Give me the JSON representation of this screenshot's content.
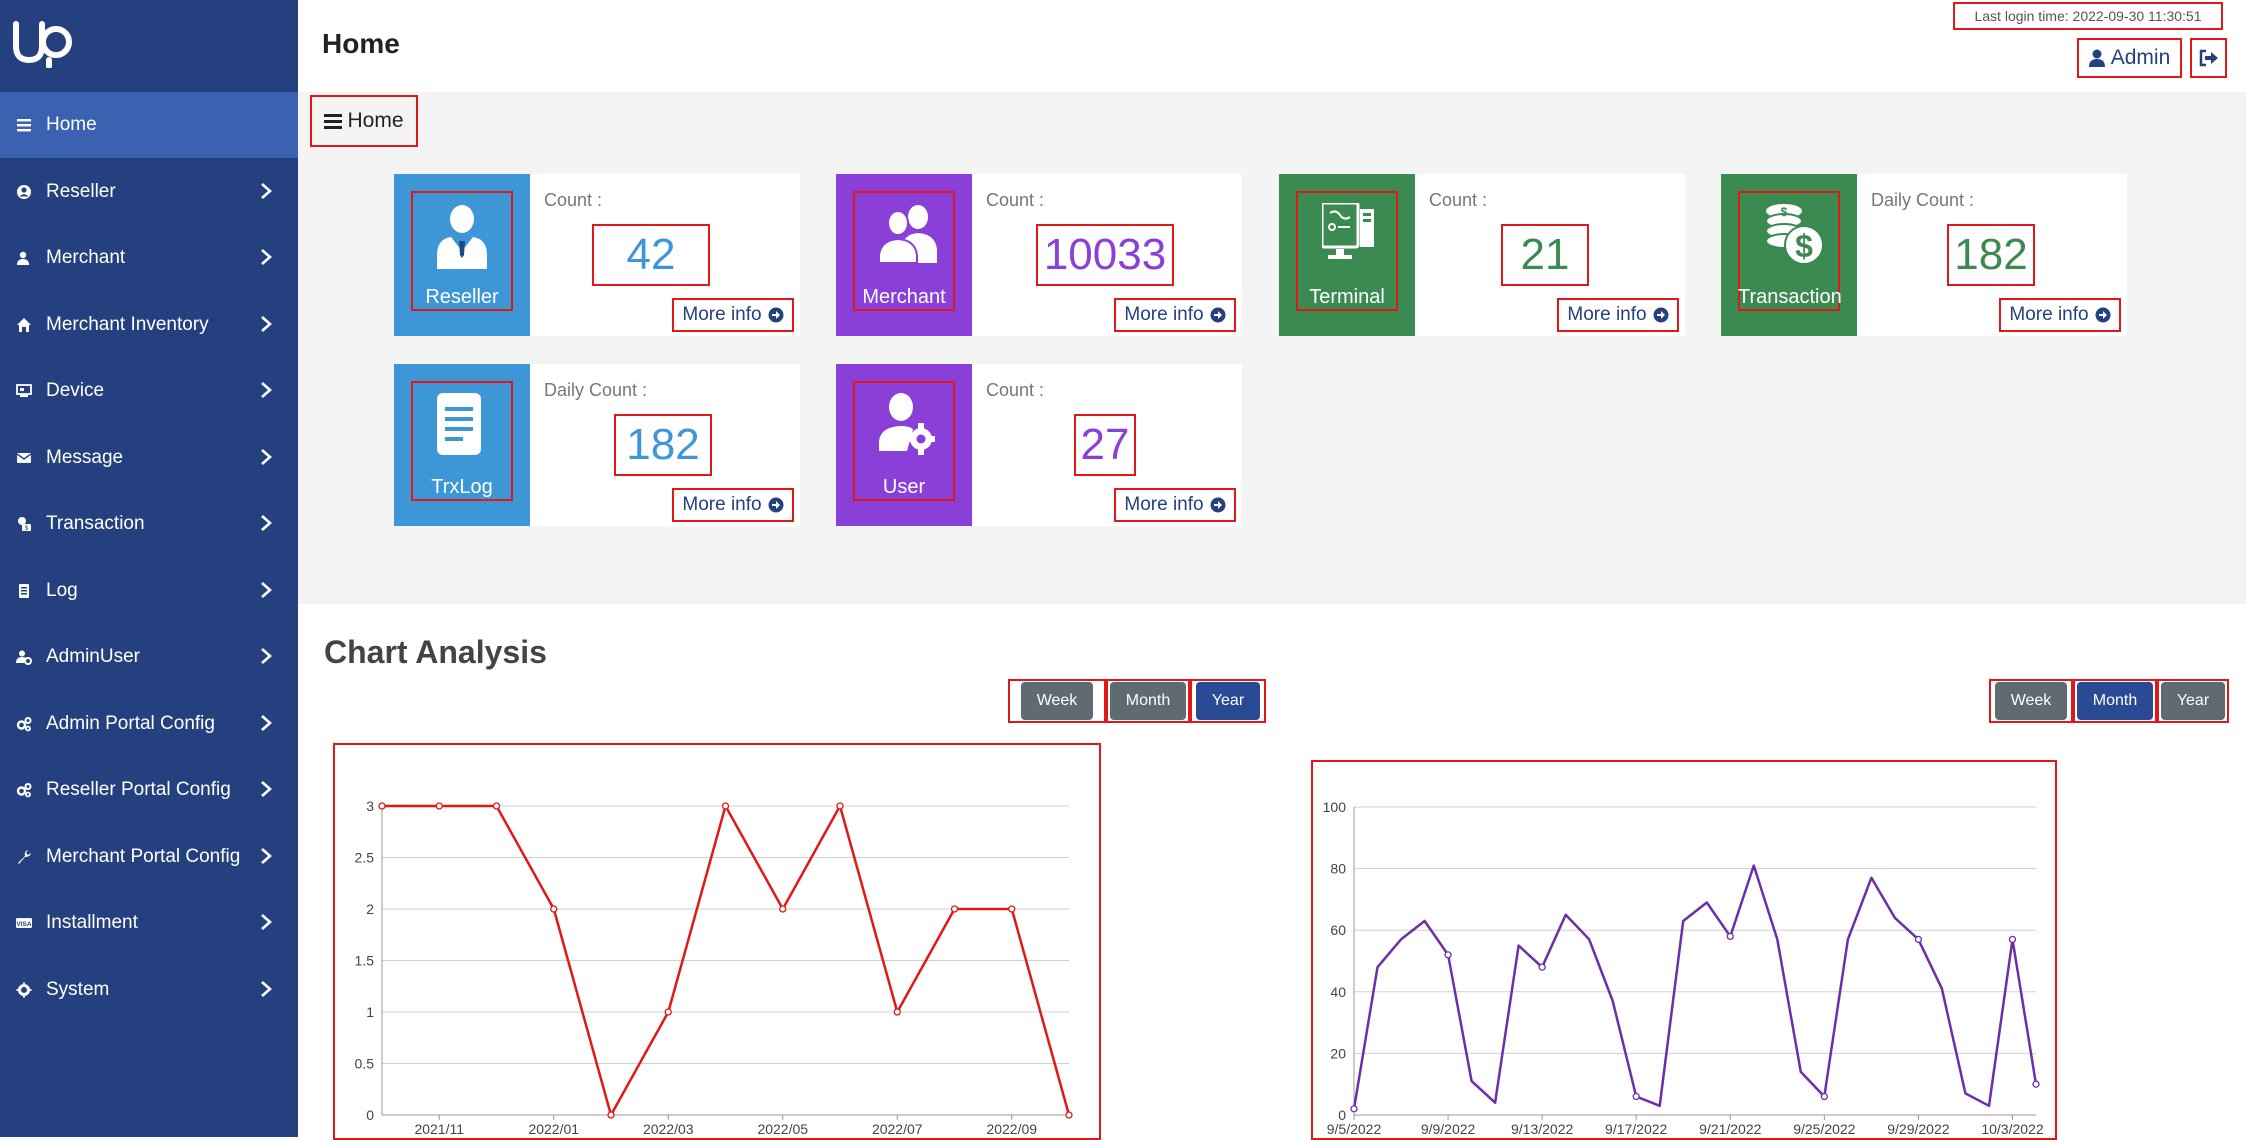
{
  "header": {
    "page_title": "Home",
    "last_login": "Last login time: 2022-09-30 11:30:51",
    "admin_label": "Admin"
  },
  "breadcrumb": "Home",
  "sidebar": {
    "items": [
      {
        "label": "Home",
        "icon": "bars-icon",
        "active": true,
        "chevron": false
      },
      {
        "label": "Reseller",
        "icon": "user-circle-icon",
        "chevron": true
      },
      {
        "label": "Merchant",
        "icon": "user-icon",
        "chevron": true
      },
      {
        "label": "Merchant Inventory",
        "icon": "home-icon",
        "chevron": true
      },
      {
        "label": "Device",
        "icon": "device-icon",
        "chevron": true
      },
      {
        "label": "Message",
        "icon": "envelope-icon",
        "chevron": true
      },
      {
        "label": "Transaction",
        "icon": "money-icon",
        "chevron": true
      },
      {
        "label": "Log",
        "icon": "document-icon",
        "chevron": true
      },
      {
        "label": "AdminUser",
        "icon": "user-gear-icon",
        "chevron": true
      },
      {
        "label": "Admin Portal Config",
        "icon": "gears-icon",
        "chevron": true
      },
      {
        "label": "Reseller Portal Config",
        "icon": "gears-icon",
        "chevron": true
      },
      {
        "label": "Merchant Portal Config",
        "icon": "wrench-icon",
        "chevron": true
      },
      {
        "label": "Installment",
        "icon": "visa-icon",
        "chevron": true
      },
      {
        "label": "System",
        "icon": "cog-icon",
        "chevron": true
      }
    ]
  },
  "cards": [
    {
      "name": "Reseller",
      "count_label": "Count :",
      "value": "42",
      "more": "More info",
      "color": "#3d96d6",
      "value_color": "#3d96d6"
    },
    {
      "name": "Merchant",
      "count_label": "Count :",
      "value": "10033",
      "more": "More info",
      "color": "#8a3fd8",
      "value_color": "#8a3fd8"
    },
    {
      "name": "Terminal",
      "count_label": "Count :",
      "value": "21",
      "more": "More info",
      "color": "#3b8a52",
      "value_color": "#3b8a52"
    },
    {
      "name": "Transaction",
      "count_label": "Daily Count :",
      "value": "182",
      "more": "More info",
      "color": "#3b8a52",
      "value_color": "#3b8a52"
    },
    {
      "name": "TrxLog",
      "count_label": "Daily Count :",
      "value": "182",
      "more": "More info",
      "color": "#3d96d6",
      "value_color": "#3d96d6"
    },
    {
      "name": "User",
      "count_label": "Count :",
      "value": "27",
      "more": "More info",
      "color": "#8a3fd8",
      "value_color": "#8a3fd8"
    }
  ],
  "chart_section": {
    "heading": "Chart Analysis",
    "left_buttons": {
      "week": "Week",
      "month": "Month",
      "year": "Year",
      "active": "year"
    },
    "right_buttons": {
      "week": "Week",
      "month": "Month",
      "year": "Year",
      "active": "month"
    }
  },
  "chart_data": [
    {
      "type": "line",
      "x": [
        "2021/10",
        "2021/11",
        "2021/12",
        "2022/01",
        "2022/02",
        "2022/03",
        "2022/04",
        "2022/05",
        "2022/06",
        "2022/07",
        "2022/08",
        "2022/09",
        "2022/10"
      ],
      "series": [
        {
          "values": [
            3,
            3,
            3,
            2,
            0,
            1,
            3,
            2,
            3,
            1,
            2,
            2,
            0
          ],
          "color": "#e01818"
        }
      ],
      "x_tick_labels": [
        "2021/11",
        "2022/01",
        "2022/03",
        "2022/05",
        "2022/07",
        "2022/09"
      ],
      "y_ticks": [
        0,
        0.5,
        1,
        1.5,
        2,
        2.5,
        3
      ],
      "ylim": [
        0,
        3
      ],
      "grid": true
    },
    {
      "type": "line",
      "x": [
        "9/5/2022",
        "9/6/2022",
        "9/7/2022",
        "9/8/2022",
        "9/9/2022",
        "9/10/2022",
        "9/11/2022",
        "9/12/2022",
        "9/13/2022",
        "9/14/2022",
        "9/15/2022",
        "9/16/2022",
        "9/17/2022",
        "9/18/2022",
        "9/19/2022",
        "9/20/2022",
        "9/21/2022",
        "9/22/2022",
        "9/23/2022",
        "9/24/2022",
        "9/25/2022",
        "9/26/2022",
        "9/27/2022",
        "9/28/2022",
        "9/29/2022",
        "9/30/2022",
        "10/1/2022",
        "10/2/2022",
        "10/3/2022",
        "10/4/2022"
      ],
      "series": [
        {
          "values": [
            2,
            48,
            57,
            63,
            52,
            11,
            4,
            55,
            48,
            65,
            57,
            37,
            6,
            3,
            63,
            69,
            58,
            81,
            57,
            14,
            6,
            57,
            77,
            64,
            57,
            41,
            7,
            3,
            57,
            10
          ],
          "color": "#6b2fa8"
        }
      ],
      "x_tick_labels": [
        "9/5/2022",
        "9/9/2022",
        "9/13/2022",
        "9/17/2022",
        "9/21/2022",
        "9/25/2022",
        "9/29/2022",
        "10/3/2022"
      ],
      "y_ticks": [
        0,
        20,
        40,
        60,
        80,
        100
      ],
      "ylim": [
        0,
        100
      ],
      "grid": true
    }
  ]
}
